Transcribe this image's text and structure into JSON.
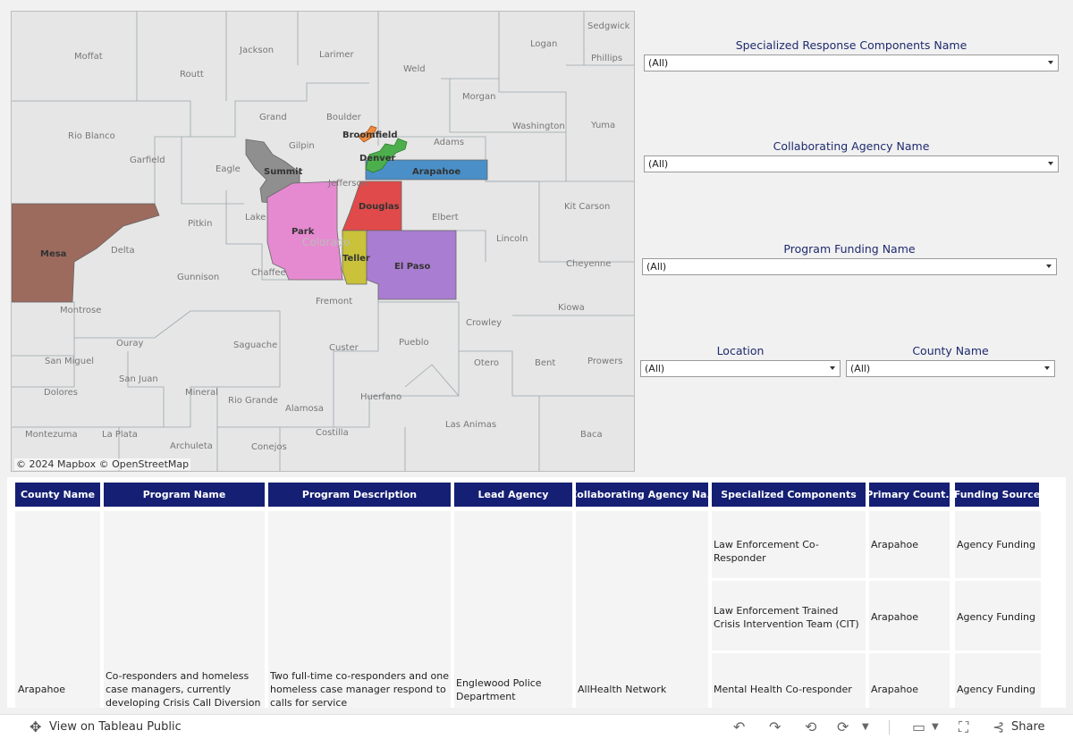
{
  "map": {
    "attribution": "© 2024 Mapbox  © OpenStreetMap",
    "state_watermark": "Colorado",
    "county_labels": [
      "Moffat",
      "Jackson",
      "Larimer",
      "Weld",
      "Logan",
      "Sedgwick",
      "Phillips",
      "Routt",
      "Grand",
      "Boulder",
      "Morgan",
      "Yuma",
      "Rio Blanco",
      "Garfield",
      "Eagle",
      "Gilpin",
      "Adams",
      "Washington",
      "Jefferson",
      "Pitkin",
      "Lake",
      "Elbert",
      "Kit Carson",
      "Delta",
      "Lincoln",
      "Cheyenne",
      "Gunnison",
      "Chaffee",
      "Fremont",
      "Kiowa",
      "Montrose",
      "Crowley",
      "Ouray",
      "Saguache",
      "Custer",
      "Pueblo",
      "Prowers",
      "San Miguel",
      "Otero",
      "Bent",
      "San Juan",
      "Dolores",
      "Mineral",
      "Rio Grande",
      "Huerfano",
      "Alamosa",
      "Las Animas",
      "Montezuma",
      "La Plata",
      "Archuleta",
      "Conejos",
      "Costilla",
      "Baca"
    ],
    "highlighted": [
      {
        "name": "Mesa",
        "color": "#9c6b5e"
      },
      {
        "name": "Summit",
        "color": "#8f8f8f"
      },
      {
        "name": "Park",
        "color": "#e58ad0"
      },
      {
        "name": "Douglas",
        "color": "#e04a4a"
      },
      {
        "name": "Teller",
        "color": "#c9c23a"
      },
      {
        "name": "El Paso",
        "color": "#a97dd1"
      },
      {
        "name": "Arapahoe",
        "color": "#4a8fc7"
      },
      {
        "name": "Denver",
        "color": "#4caf4c"
      },
      {
        "name": "Broomfield",
        "color": "#f08a3c"
      }
    ]
  },
  "filters": {
    "components": {
      "title": "Specialized Response Components Name",
      "value": "(All)"
    },
    "agency": {
      "title": "Collaborating Agency Name",
      "value": "(All)"
    },
    "funding": {
      "title": "Program Funding Name",
      "value": "(All)"
    },
    "location": {
      "title": "Location",
      "value": "(All)"
    },
    "county": {
      "title": "County Name",
      "value": "(All)"
    }
  },
  "table": {
    "headers": [
      "County Name",
      "Program Name",
      "Program Description",
      "Lead Agency",
      "Collaborating Agency Na..",
      "Specialized Components",
      "Primary Count..",
      "Funding Source"
    ],
    "row": {
      "county": "Arapahoe",
      "program_name": "Co-responders and homeless case managers, currently developing Crisis Call Diversion to BMCP",
      "description": "Two full-time co-responders and one homeless case manager respond to calls for service",
      "lead_agency": "Englewood Police Department",
      "collab_agency": "AllHealth Network",
      "sub_rows": [
        {
          "component": "Law Enforcement Co-Responder",
          "primary_county": "Arapahoe",
          "funding": "Agency Funding"
        },
        {
          "component": "Law Enforcement Trained Crisis Intervention Team (CIT)",
          "primary_county": "Arapahoe",
          "funding": "Agency Funding"
        },
        {
          "component": "Mental Health Co-responder",
          "primary_county": "Arapahoe",
          "funding": "Agency Funding"
        }
      ]
    }
  },
  "footer": {
    "view_label": "View on Tableau Public",
    "share_label": "Share"
  }
}
